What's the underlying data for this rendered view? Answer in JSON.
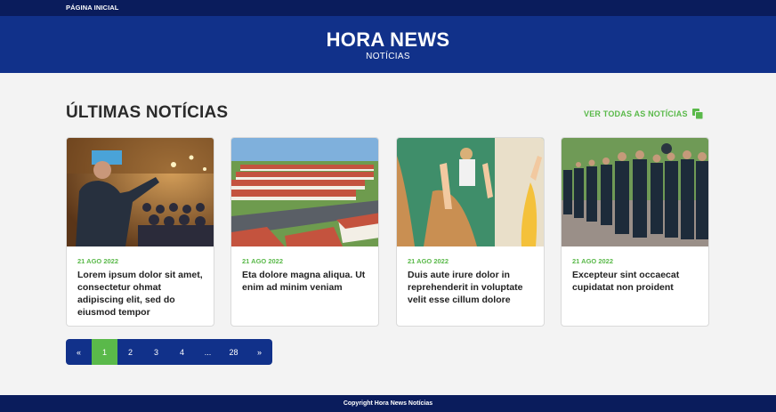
{
  "nav": {
    "home_label": "PÁGINA INICIAL"
  },
  "header": {
    "title": "HORA NEWS",
    "subtitle": "NOTÍCIAS"
  },
  "section": {
    "title": "ÚLTIMAS NOTÍCIAS",
    "see_all_label": "VER TODAS AS NOTÍCIAS",
    "see_all_icon": "copy-icon"
  },
  "cards": [
    {
      "date": "21 AGO 2022",
      "headline": "Lorem ipsum dolor sit amet, consectetur ohmat adipiscing elit, sed do eiusmod tempor"
    },
    {
      "date": "21 AGO 2022",
      "headline": "Eta dolore magna aliqua. Ut enim ad minim veniam"
    },
    {
      "date": "21 AGO 2022",
      "headline": "Duis aute irure dolor in reprehenderit in voluptate velit esse cillum dolore"
    },
    {
      "date": "21 AGO 2022",
      "headline": "Excepteur sint occaecat cupidatat non proident"
    }
  ],
  "pagination": {
    "prev": "«",
    "pages": [
      "1",
      "2",
      "3",
      "4",
      "...",
      "28"
    ],
    "next": "»",
    "active": "1"
  },
  "footer": {
    "copyright": "Copyright Hora News Notícias"
  },
  "colors": {
    "navy": "#0a1c5c",
    "blue": "#11318a",
    "green": "#5ab94a"
  }
}
